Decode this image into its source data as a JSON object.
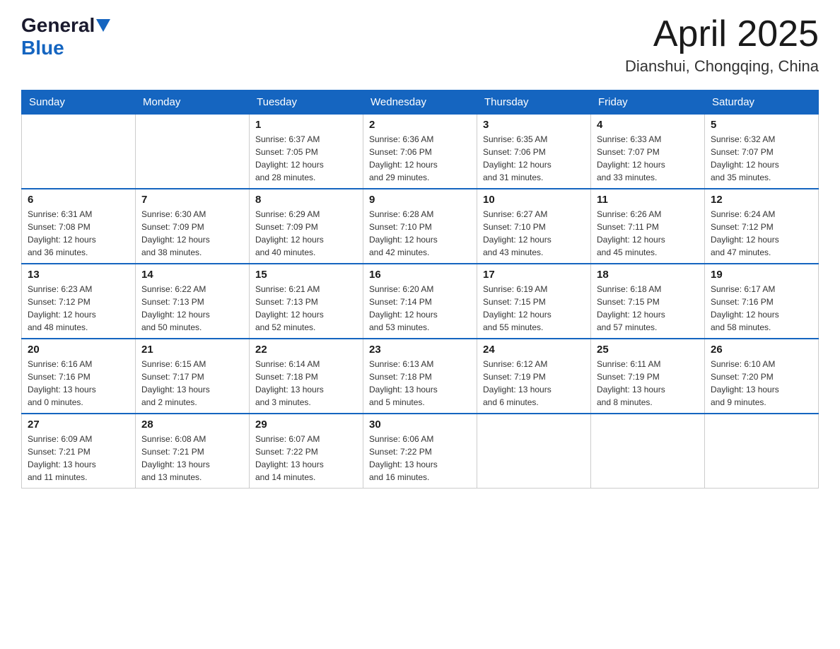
{
  "header": {
    "logo": {
      "general": "General",
      "arrow": "▲",
      "blue": "Blue"
    },
    "title": "April 2025",
    "location": "Dianshui, Chongqing, China"
  },
  "weekdays": [
    "Sunday",
    "Monday",
    "Tuesday",
    "Wednesday",
    "Thursday",
    "Friday",
    "Saturday"
  ],
  "weeks": [
    [
      {
        "day": "",
        "detail": ""
      },
      {
        "day": "",
        "detail": ""
      },
      {
        "day": "1",
        "detail": "Sunrise: 6:37 AM\nSunset: 7:05 PM\nDaylight: 12 hours\nand 28 minutes."
      },
      {
        "day": "2",
        "detail": "Sunrise: 6:36 AM\nSunset: 7:06 PM\nDaylight: 12 hours\nand 29 minutes."
      },
      {
        "day": "3",
        "detail": "Sunrise: 6:35 AM\nSunset: 7:06 PM\nDaylight: 12 hours\nand 31 minutes."
      },
      {
        "day": "4",
        "detail": "Sunrise: 6:33 AM\nSunset: 7:07 PM\nDaylight: 12 hours\nand 33 minutes."
      },
      {
        "day": "5",
        "detail": "Sunrise: 6:32 AM\nSunset: 7:07 PM\nDaylight: 12 hours\nand 35 minutes."
      }
    ],
    [
      {
        "day": "6",
        "detail": "Sunrise: 6:31 AM\nSunset: 7:08 PM\nDaylight: 12 hours\nand 36 minutes."
      },
      {
        "day": "7",
        "detail": "Sunrise: 6:30 AM\nSunset: 7:09 PM\nDaylight: 12 hours\nand 38 minutes."
      },
      {
        "day": "8",
        "detail": "Sunrise: 6:29 AM\nSunset: 7:09 PM\nDaylight: 12 hours\nand 40 minutes."
      },
      {
        "day": "9",
        "detail": "Sunrise: 6:28 AM\nSunset: 7:10 PM\nDaylight: 12 hours\nand 42 minutes."
      },
      {
        "day": "10",
        "detail": "Sunrise: 6:27 AM\nSunset: 7:10 PM\nDaylight: 12 hours\nand 43 minutes."
      },
      {
        "day": "11",
        "detail": "Sunrise: 6:26 AM\nSunset: 7:11 PM\nDaylight: 12 hours\nand 45 minutes."
      },
      {
        "day": "12",
        "detail": "Sunrise: 6:24 AM\nSunset: 7:12 PM\nDaylight: 12 hours\nand 47 minutes."
      }
    ],
    [
      {
        "day": "13",
        "detail": "Sunrise: 6:23 AM\nSunset: 7:12 PM\nDaylight: 12 hours\nand 48 minutes."
      },
      {
        "day": "14",
        "detail": "Sunrise: 6:22 AM\nSunset: 7:13 PM\nDaylight: 12 hours\nand 50 minutes."
      },
      {
        "day": "15",
        "detail": "Sunrise: 6:21 AM\nSunset: 7:13 PM\nDaylight: 12 hours\nand 52 minutes."
      },
      {
        "day": "16",
        "detail": "Sunrise: 6:20 AM\nSunset: 7:14 PM\nDaylight: 12 hours\nand 53 minutes."
      },
      {
        "day": "17",
        "detail": "Sunrise: 6:19 AM\nSunset: 7:15 PM\nDaylight: 12 hours\nand 55 minutes."
      },
      {
        "day": "18",
        "detail": "Sunrise: 6:18 AM\nSunset: 7:15 PM\nDaylight: 12 hours\nand 57 minutes."
      },
      {
        "day": "19",
        "detail": "Sunrise: 6:17 AM\nSunset: 7:16 PM\nDaylight: 12 hours\nand 58 minutes."
      }
    ],
    [
      {
        "day": "20",
        "detail": "Sunrise: 6:16 AM\nSunset: 7:16 PM\nDaylight: 13 hours\nand 0 minutes."
      },
      {
        "day": "21",
        "detail": "Sunrise: 6:15 AM\nSunset: 7:17 PM\nDaylight: 13 hours\nand 2 minutes."
      },
      {
        "day": "22",
        "detail": "Sunrise: 6:14 AM\nSunset: 7:18 PM\nDaylight: 13 hours\nand 3 minutes."
      },
      {
        "day": "23",
        "detail": "Sunrise: 6:13 AM\nSunset: 7:18 PM\nDaylight: 13 hours\nand 5 minutes."
      },
      {
        "day": "24",
        "detail": "Sunrise: 6:12 AM\nSunset: 7:19 PM\nDaylight: 13 hours\nand 6 minutes."
      },
      {
        "day": "25",
        "detail": "Sunrise: 6:11 AM\nSunset: 7:19 PM\nDaylight: 13 hours\nand 8 minutes."
      },
      {
        "day": "26",
        "detail": "Sunrise: 6:10 AM\nSunset: 7:20 PM\nDaylight: 13 hours\nand 9 minutes."
      }
    ],
    [
      {
        "day": "27",
        "detail": "Sunrise: 6:09 AM\nSunset: 7:21 PM\nDaylight: 13 hours\nand 11 minutes."
      },
      {
        "day": "28",
        "detail": "Sunrise: 6:08 AM\nSunset: 7:21 PM\nDaylight: 13 hours\nand 13 minutes."
      },
      {
        "day": "29",
        "detail": "Sunrise: 6:07 AM\nSunset: 7:22 PM\nDaylight: 13 hours\nand 14 minutes."
      },
      {
        "day": "30",
        "detail": "Sunrise: 6:06 AM\nSunset: 7:22 PM\nDaylight: 13 hours\nand 16 minutes."
      },
      {
        "day": "",
        "detail": ""
      },
      {
        "day": "",
        "detail": ""
      },
      {
        "day": "",
        "detail": ""
      }
    ]
  ]
}
